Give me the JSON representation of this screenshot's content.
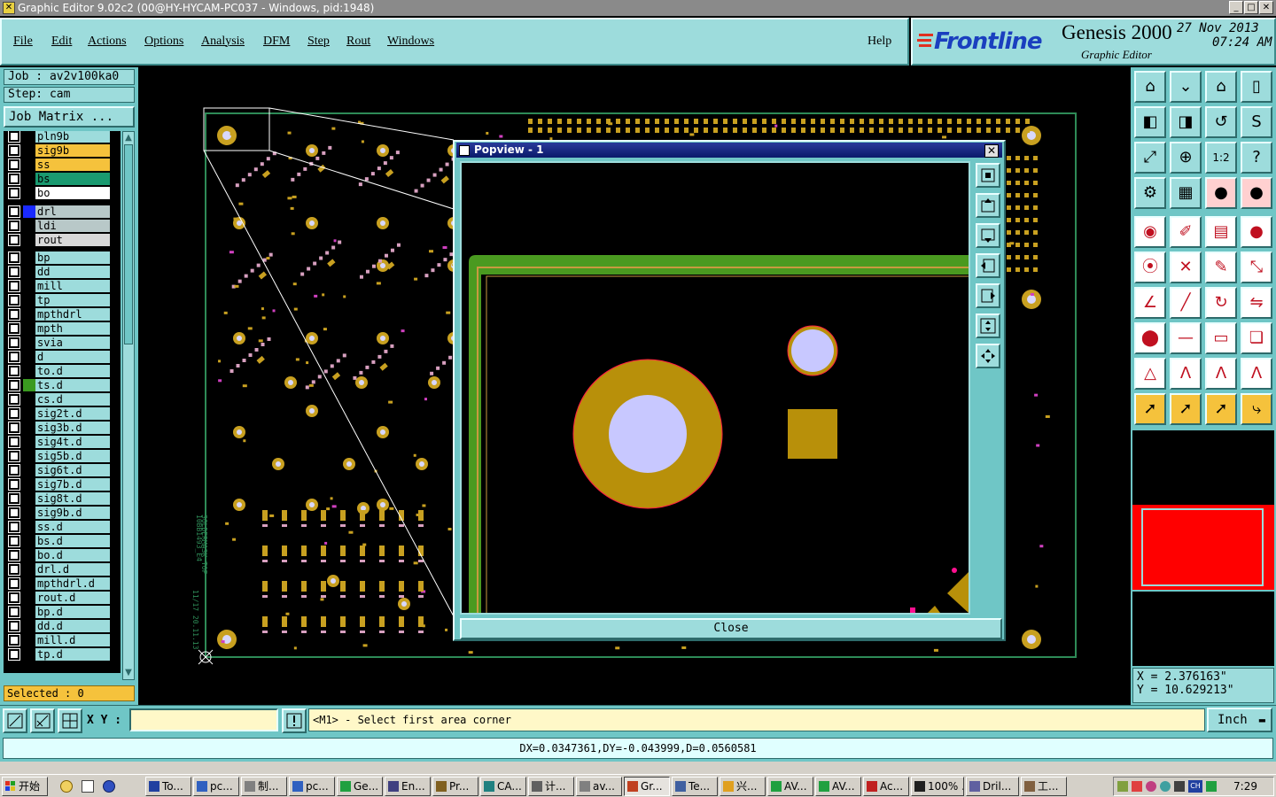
{
  "window": {
    "title": "Graphic Editor 9.02c2 (00@HY-HYCAM-PC037 - Windows, pid:1948)"
  },
  "menu": {
    "items": [
      "File",
      "Edit",
      "Actions",
      "Options",
      "Analysis",
      "DFM",
      "Step",
      "Rout",
      "Windows"
    ],
    "help": "Help"
  },
  "brand": {
    "logo": "Frontline",
    "product": "Genesis 2000",
    "subtitle": "Graphic Editor",
    "date": "27 Nov 2013",
    "time": "07:24 AM"
  },
  "job": {
    "job_label": "Job : av2v100ka0",
    "step_label": "Step: cam",
    "matrix_button": "Job Matrix ..."
  },
  "layers": [
    {
      "name": "pln9b",
      "color": "#9ddcdc",
      "swatch": ""
    },
    {
      "name": "sig9b",
      "color": "#f5c23c",
      "swatch": ""
    },
    {
      "name": "ss",
      "color": "#f5c23c",
      "swatch": ""
    },
    {
      "name": "bs",
      "color": "#1a9a70",
      "swatch": ""
    },
    {
      "name": "bo",
      "color": "#ffffff",
      "swatch": ""
    },
    {
      "name": "drl",
      "color": "#b8c8c8",
      "swatch": "#1a2aff"
    },
    {
      "name": "ldi",
      "color": "#b8c8c8",
      "swatch": ""
    },
    {
      "name": "rout",
      "color": "#d8d8d8",
      "swatch": ""
    },
    {
      "name": "bp",
      "color": "#9ddcdc",
      "swatch": ""
    },
    {
      "name": "dd",
      "color": "#9ddcdc",
      "swatch": ""
    },
    {
      "name": "mill",
      "color": "#9ddcdc",
      "swatch": ""
    },
    {
      "name": "tp",
      "color": "#9ddcdc",
      "swatch": ""
    },
    {
      "name": "mpthdrl",
      "color": "#9ddcdc",
      "swatch": ""
    },
    {
      "name": "mpth",
      "color": "#9ddcdc",
      "swatch": ""
    },
    {
      "name": "svia",
      "color": "#9ddcdc",
      "swatch": ""
    },
    {
      "name": "d",
      "color": "#9ddcdc",
      "swatch": ""
    },
    {
      "name": "to.d",
      "color": "#9ddcdc",
      "swatch": ""
    },
    {
      "name": "ts.d",
      "color": "#9ddcdc",
      "swatch": "#3a9a20"
    },
    {
      "name": "cs.d",
      "color": "#9ddcdc",
      "swatch": ""
    },
    {
      "name": "sig2t.d",
      "color": "#9ddcdc",
      "swatch": ""
    },
    {
      "name": "sig3b.d",
      "color": "#9ddcdc",
      "swatch": ""
    },
    {
      "name": "sig4t.d",
      "color": "#9ddcdc",
      "swatch": ""
    },
    {
      "name": "sig5b.d",
      "color": "#9ddcdc",
      "swatch": ""
    },
    {
      "name": "sig6t.d",
      "color": "#9ddcdc",
      "swatch": ""
    },
    {
      "name": "sig7b.d",
      "color": "#9ddcdc",
      "swatch": ""
    },
    {
      "name": "sig8t.d",
      "color": "#9ddcdc",
      "swatch": ""
    },
    {
      "name": "sig9b.d",
      "color": "#9ddcdc",
      "swatch": ""
    },
    {
      "name": "ss.d",
      "color": "#9ddcdc",
      "swatch": ""
    },
    {
      "name": "bs.d",
      "color": "#9ddcdc",
      "swatch": ""
    },
    {
      "name": "bo.d",
      "color": "#9ddcdc",
      "swatch": ""
    },
    {
      "name": "drl.d",
      "color": "#9ddcdc",
      "swatch": ""
    },
    {
      "name": "mpthdrl.d",
      "color": "#9ddcdc",
      "swatch": ""
    },
    {
      "name": "rout.d",
      "color": "#9ddcdc",
      "swatch": ""
    },
    {
      "name": "bp.d",
      "color": "#9ddcdc",
      "swatch": ""
    },
    {
      "name": "dd.d",
      "color": "#9ddcdc",
      "swatch": ""
    },
    {
      "name": "mill.d",
      "color": "#9ddcdc",
      "swatch": ""
    },
    {
      "name": "tp.d",
      "color": "#9ddcdc",
      "swatch": ""
    }
  ],
  "selected": "Selected : 0",
  "popview": {
    "title": "Popview - 1",
    "close_label": "Close",
    "close_x": "✕"
  },
  "coords": {
    "x": "X  =  2.376163\"",
    "y": "Y  = 10.629213\""
  },
  "bottom": {
    "xy_label": "X Y :",
    "xy_value": "",
    "prompt": "<M1> - Select first area corner",
    "unit": "Inch"
  },
  "measure": "DX=0.0347361,DY=-0.043999,D=0.0560581",
  "taskbar": {
    "start": "开始",
    "tasks": [
      "To...",
      "pc...",
      "制...",
      "pc...",
      "Ge...",
      "En...",
      "Pr...",
      "CA...",
      "计...",
      "av...",
      "Gr...",
      "Te...",
      "兴...",
      "AV...",
      "AV...",
      "Ac...",
      "100% ...",
      "Dril...",
      "工..."
    ],
    "active_index": 10,
    "clock": "7:29"
  },
  "board_text": {
    "vert1": "10BB1493_E4",
    "vert2": "SOLDERMASK_TOP",
    "vert3": "11/17   20.11.13"
  }
}
